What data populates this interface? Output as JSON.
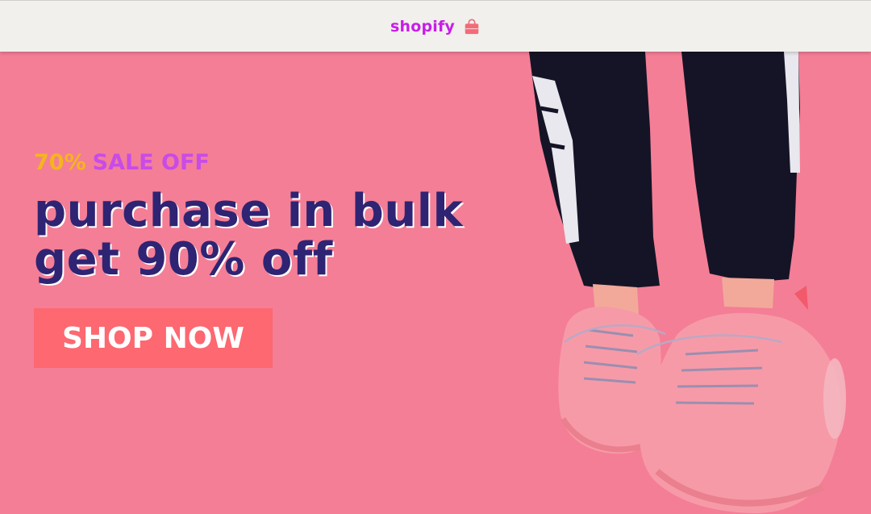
{
  "header": {
    "brand_label": "shopify",
    "brand_icon": "shopping-bag-icon"
  },
  "hero": {
    "sale_percent": "70%",
    "sale_text": "SALE OFF",
    "headline_line1": "purchase in bulk",
    "headline_line2": "get 90% off",
    "cta_label": "SHOP NOW",
    "image_subject": "pink sneakers with dark track pants"
  },
  "colors": {
    "page_background": "#f47e96",
    "header_background": "#f1f0ec",
    "brand_text": "#c81ee6",
    "bag_icon": "#f26b78",
    "sale_percent": "#f4b51d",
    "sale_text": "#c84be8",
    "headline": "#2e2473",
    "cta_background": "#fd6871",
    "cta_text": "#ffffff",
    "pants": "#151426",
    "sneakers": "#f79aa8"
  }
}
